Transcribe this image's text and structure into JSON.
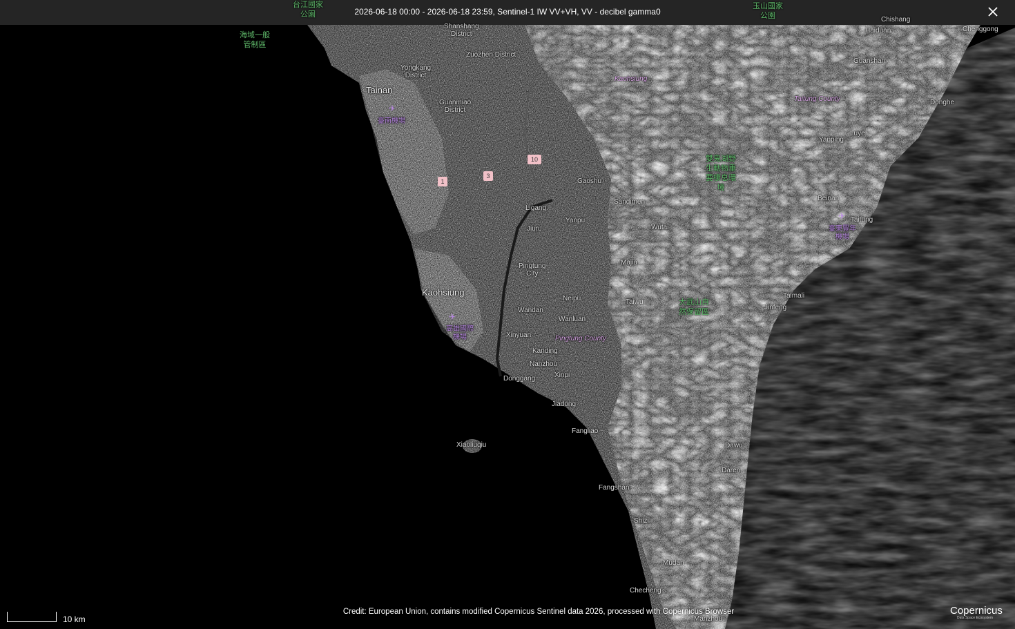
{
  "banner": {
    "title": "2026-06-18 00:00 - 2026-06-18 23:59, Sentinel-1 IW VV+VH, VV - decibel gamma0"
  },
  "labels": {
    "tainan": "Tainan",
    "kaohsiung": "Kaohsiung",
    "xiaoliuqiu": "Xiaoliuqiu",
    "shanshang": "Shanshang\nDistrict",
    "zuozhen": "Zuozhen District",
    "yongkang": "Yongkang\nDistrict",
    "guanmiao": "Guanmiao\nDistrict",
    "gaoshu": "Gaoshu",
    "ligang": "Ligang",
    "jiuru": "Jiuru",
    "yanpu": "Yanpu",
    "sandimen": "Sandimen",
    "wutai": "Wutai",
    "majia": "Majia",
    "taiwu": "Taiwu",
    "pingtung": "Pingtung\nCity",
    "neipu": "Neipu",
    "wandan": "Wandan",
    "wanluan": "Wanluan",
    "xinyuan": "Xinyuan",
    "kanding": "Kanding",
    "nanzhou": "Nanzhou",
    "xinpi": "Xinpi",
    "donggang": "Donggang",
    "jiadong": "Jiadong",
    "fangliao": "Fangliao",
    "fangshan": "Fangshan",
    "shizi": "Shizi",
    "mudan": "Mudan",
    "checheng": "Checheng",
    "manzhou": "Manzhou",
    "dawu": "Dawu",
    "daren": "Daren",
    "jinfeng": "Jinfeng",
    "taimali": "Taimali",
    "taitung": "Taitung",
    "beinan": "Beinan",
    "yanping": "Yanping",
    "luye": "Luye",
    "guanshan": "Guanshan",
    "haiduan": "Haiduan",
    "chenggong": "Chenggong",
    "donghe": "Donghe",
    "chishang": "Chishang",
    "kaohsiung_city": "Kaohsiung",
    "taitung_county": "Taitung County",
    "pingtung_county": "Pingtung County",
    "sea_zone": "海域一般\n管制區",
    "reserve_north": "雙鬼湖野\n生動物重\n要棲息環\n境",
    "reserve_dawu": "大武山自\n然保留區",
    "airport_tainan": "臺南機場",
    "airport_kaohsiung": "高雄國際\n機場",
    "airport_taitung": "臺東豐年\n機場",
    "top_green_left": "台江國家\n公園",
    "top_green_right": "玉山國家\n公園"
  },
  "shields": [
    "1",
    "3",
    "10"
  ],
  "scale": {
    "label": "10 km"
  },
  "credit": {
    "text": "Credit: European Union, contains modified Copernicus Sentinel data 2026, processed with Copernicus Browser"
  },
  "logo": {
    "name": "Copernicus",
    "sub": "Data Space Ecosystem"
  }
}
